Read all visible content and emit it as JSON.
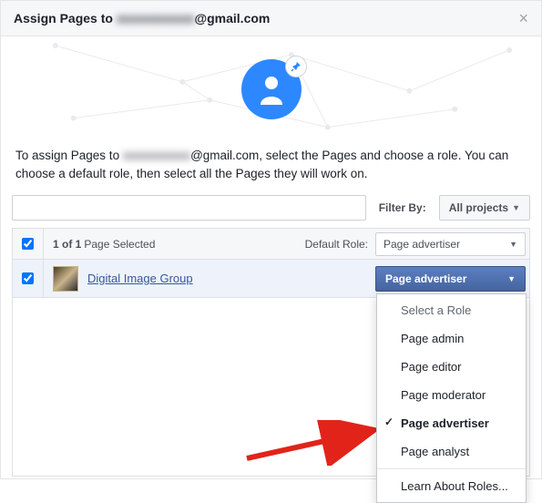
{
  "modal": {
    "title_prefix": "Assign Pages to ",
    "email_obscured": "xxxxxxxxxxx",
    "email_domain": "@gmail.com"
  },
  "description": {
    "part1": "To assign Pages to ",
    "part2": "@gmail.com, select the Pages and choose a role. You can choose a default role, then select all the Pages they will work on."
  },
  "filter": {
    "label": "Filter By:",
    "button": "All projects"
  },
  "header_row": {
    "count_bold": "1 of 1",
    "count_rest": " Page Selected",
    "default_role_label": "Default Role:",
    "default_role_value": "Page advertiser"
  },
  "row": {
    "page_name": "Digital Image Group",
    "role_value": "Page advertiser"
  },
  "dropdown": {
    "header": "Select a Role",
    "options": [
      "Page admin",
      "Page editor",
      "Page moderator",
      "Page advertiser",
      "Page analyst"
    ],
    "selected": "Page advertiser",
    "learn": "Learn About Roles..."
  },
  "search": {
    "placeholder": ""
  }
}
